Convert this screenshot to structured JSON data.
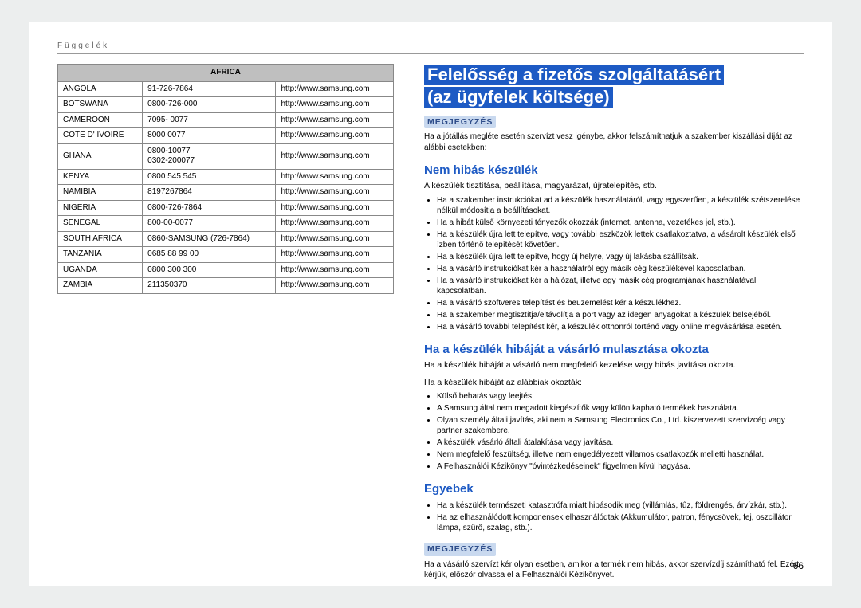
{
  "header_section": "Függelék",
  "table": {
    "region": "AFRICA",
    "rows": [
      {
        "c": "ANGOLA",
        "p": "91-726-7864",
        "u": "http://www.samsung.com"
      },
      {
        "c": "BOTSWANA",
        "p": "0800-726-000",
        "u": "http://www.samsung.com"
      },
      {
        "c": "CAMEROON",
        "p": "7095- 0077",
        "u": "http://www.samsung.com"
      },
      {
        "c": "COTE D' IVOIRE",
        "p": "8000 0077",
        "u": "http://www.samsung.com"
      },
      {
        "c": "GHANA",
        "p": "0800-10077\n0302-200077",
        "u": "http://www.samsung.com"
      },
      {
        "c": "KENYA",
        "p": "0800 545 545",
        "u": "http://www.samsung.com"
      },
      {
        "c": "NAMIBIA",
        "p": "8197267864",
        "u": "http://www.samsung.com"
      },
      {
        "c": "NIGERIA",
        "p": "0800-726-7864",
        "u": "http://www.samsung.com"
      },
      {
        "c": "SENEGAL",
        "p": "800-00-0077",
        "u": "http://www.samsung.com"
      },
      {
        "c": "SOUTH AFRICA",
        "p": "0860-SAMSUNG (726-7864)",
        "u": "http://www.samsung.com"
      },
      {
        "c": "TANZANIA",
        "p": "0685 88 99 00",
        "u": "http://www.samsung.com"
      },
      {
        "c": "UGANDA",
        "p": "0800 300 300",
        "u": "http://www.samsung.com"
      },
      {
        "c": "ZAMBIA",
        "p": "211350370",
        "u": "http://www.samsung.com"
      }
    ]
  },
  "title_line1": "Felelősség a fizetős szolgáltatásért",
  "title_line2": "(az ügyfelek költsége)",
  "note_label": "MEGJEGYZÉS",
  "note1_text": "Ha a jótállás megléte esetén szervízt vesz igénybe, akkor felszámíthatjuk a szakember kiszállási díját az alábbi esetekben:",
  "sub1_heading": "Nem hibás készülék",
  "sub1_para": "A készülék tisztítása, beállítása, magyarázat, újratelepítés, stb.",
  "sub1_bullets": [
    "Ha a szakember instrukciókat ad a készülék használatáról, vagy egyszerűen, a készülék szétszerelése nélkül módosítja a beállításokat.",
    "Ha a hibát külső környezeti tényezők okozzák (internet, antenna, vezetékes jel, stb.).",
    "Ha a készülék újra lett telepítve, vagy további eszközök lettek csatlakoztatva, a vásárolt készülék első ízben történő telepítését követően.",
    "Ha a készülék újra lett telepítve, hogy új helyre, vagy új lakásba szállítsák.",
    "Ha a vásárló instrukciókat kér a használatról egy másik cég készülékével kapcsolatban.",
    "Ha a vásárló instrukciókat kér a hálózat, illetve egy másik cég programjának használatával kapcsolatban.",
    "Ha a vásárló szoftveres telepítést és beüzemelést kér a készülékhez.",
    "Ha a szakember megtisztítja/eltávolítja a port vagy az idegen anyagokat a készülék belsejéből.",
    "Ha a vásárló további telepítést kér, a készülék otthonról történő vagy online megvásárlása esetén."
  ],
  "sub2_heading": "Ha a készülék hibáját a vásárló mulasztása okozta",
  "sub2_para1": "Ha a készülék hibáját a vásárló nem megfelelő kezelése vagy hibás javítása okozta.",
  "sub2_para2": "Ha a készülék hibáját az alábbiak okozták:",
  "sub2_bullets": [
    "Külső behatás vagy leejtés.",
    "A Samsung által nem megadott kiegészítők vagy külön kapható termékek használata.",
    "Olyan személy általi javítás, aki nem a Samsung Electronics Co., Ltd. kiszervezett szervízcég vagy partner szakembere.",
    "A készülék vásárló általi átalakítása vagy javítása.",
    "Nem megfelelő feszültség, illetve nem engedélyezett villamos csatlakozók melletti használat.",
    "A Felhasználói Kézikönyv \"óvintézkedéseinek\" figyelmen kívül hagyása."
  ],
  "sub3_heading": "Egyebek",
  "sub3_bullets": [
    "Ha a készülék természeti katasztrófa miatt hibásodik meg (villámlás, tűz, földrengés, árvízkár, stb.).",
    "Ha az elhasználódott komponensek elhasználódtak (Akkumulátor, patron, fénycsövek, fej, oszcillátor, lámpa, szűrő, szalag, stb.)."
  ],
  "note2_text": "Ha a vásárló szervízt kér olyan esetben, amikor a termék nem hibás, akkor szervízdíj számítható fel. Ezért kérjük, először olvassa el a Felhasználói Kézikönyvet.",
  "page_number": "66"
}
